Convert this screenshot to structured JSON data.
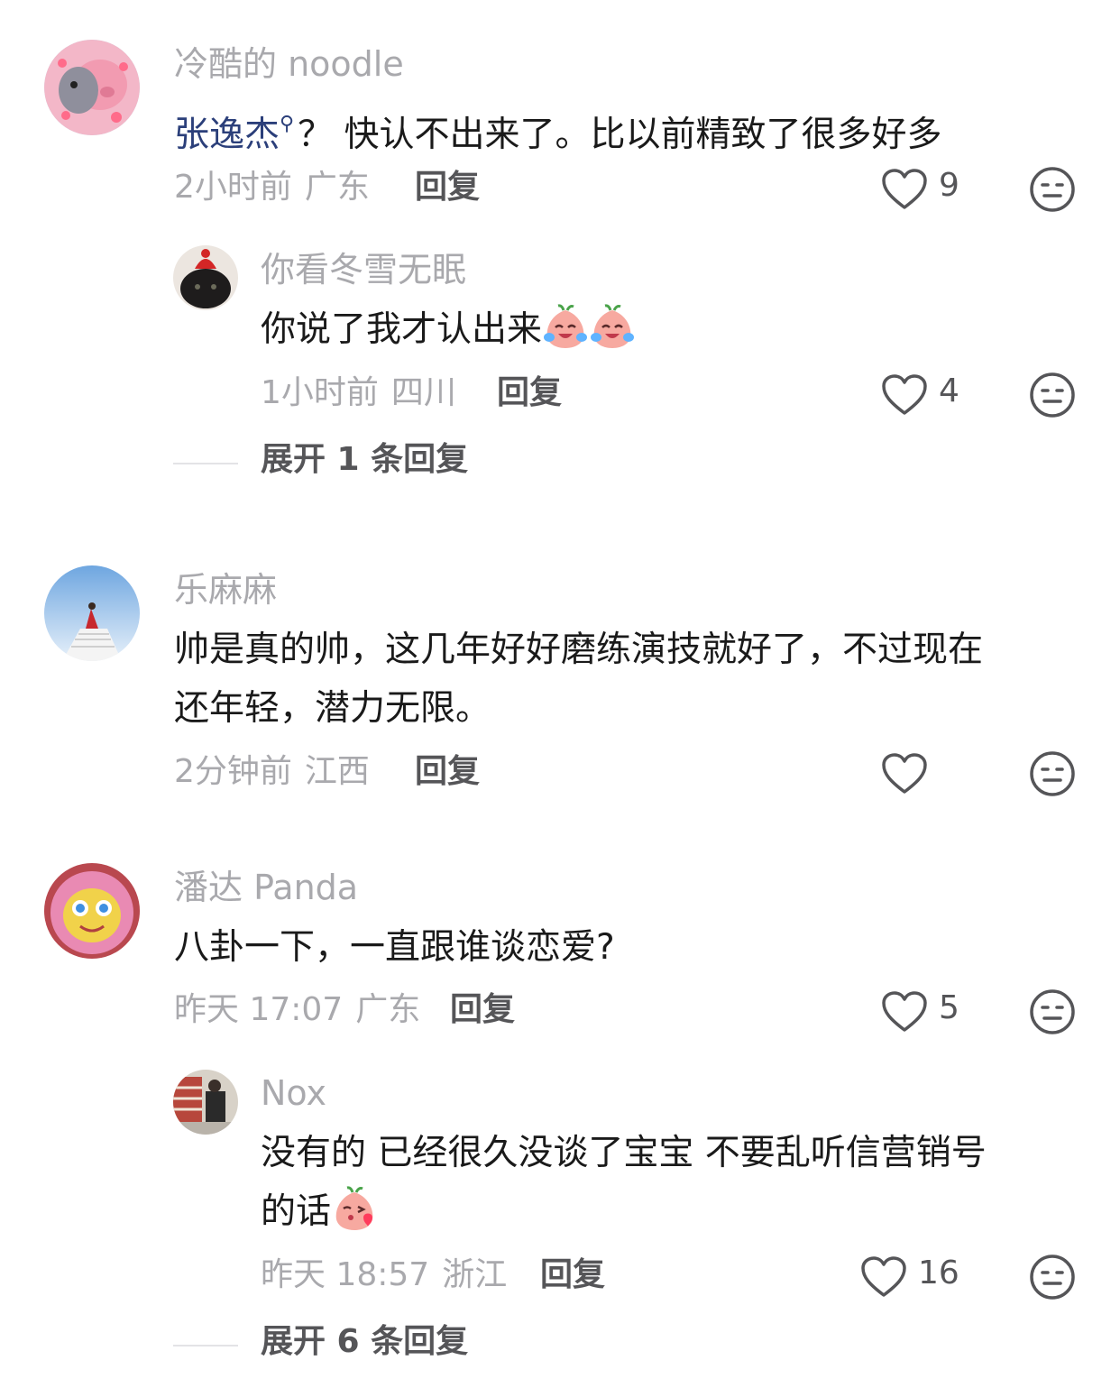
{
  "comments": [
    {
      "user": "冷酷的 noodle",
      "text_link": "张逸杰",
      "text_rest": "？ 快认不出来了。比以前精致了很多好多",
      "time": "2小时前",
      "location": "广东",
      "reply_label": "回复",
      "likes": "9",
      "avatar_icon": "pink-pig-cartoon-avatar",
      "replies": [
        {
          "user": "你看冬雪无眠",
          "text": "你说了我才认出来",
          "time": "1小时前",
          "location": "四川",
          "reply_label": "回复",
          "likes": "4",
          "avatar_icon": "black-cat-red-hat-avatar",
          "emoji": [
            "crying-laughing-peach-emoji",
            "crying-laughing-peach-emoji"
          ]
        }
      ],
      "expand_label": "展开 1 条回复"
    },
    {
      "user": "乐麻麻",
      "text_line1": "帅是真的帅，这几年好好磨练演技就好了，不过现在",
      "text_line2": "还年轻，潜力无限。",
      "time": "2分钟前",
      "location": "江西",
      "reply_label": "回复",
      "likes": "",
      "avatar_icon": "sky-staircase-avatar"
    },
    {
      "user": "潘达 Panda",
      "text": "八卦一下，一直跟谁谈恋爱?",
      "time": "昨天 17:07",
      "location": "广东",
      "reply_label": "回复",
      "likes": "5",
      "avatar_icon": "yellow-plush-pink-hood-avatar",
      "replies": [
        {
          "user": "Nox",
          "text_line1": "没有的 已经很久没谈了宝宝 不要乱听信营销号",
          "text_line2": "的话",
          "time": "昨天 18:57",
          "location": "浙江",
          "reply_label": "回复",
          "likes": "16",
          "avatar_icon": "store-shelf-photo-avatar",
          "emoji": [
            "blowing-kiss-peach-emoji"
          ]
        }
      ],
      "expand_label": "展开 6 条回复"
    }
  ],
  "colors": {
    "username": "#a9a9ad",
    "body_text": "#1a1a1a",
    "link": "#2b3f7a",
    "action": "#555558"
  }
}
